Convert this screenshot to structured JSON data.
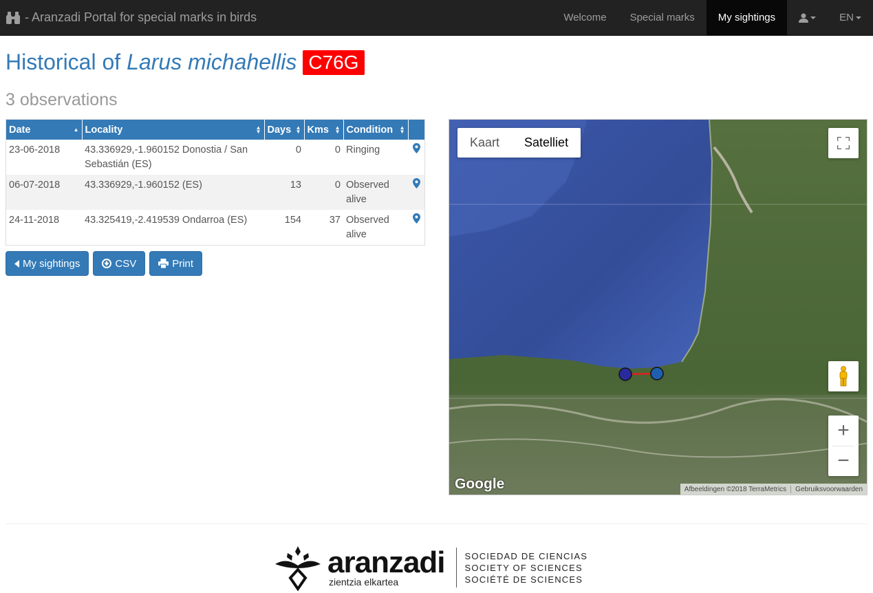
{
  "navbar": {
    "brand": "- Aranzadi Portal for special marks in birds",
    "items": [
      {
        "label": "Welcome",
        "active": false
      },
      {
        "label": "Special marks",
        "active": false
      },
      {
        "label": "My sightings",
        "active": true
      }
    ],
    "language": "EN"
  },
  "page": {
    "title_prefix": "Historical of",
    "species": "Larus michahellis",
    "mark_code": "C76G",
    "observations": "3 observations"
  },
  "table": {
    "headers": [
      "Date",
      "Locality",
      "Days",
      "Kms",
      "Condition"
    ],
    "rows": [
      {
        "date": "23-06-2018",
        "locality": "43.336929,-1.960152 Donostia / San Sebastián (ES)",
        "days": "0",
        "kms": "0",
        "condition": "Ringing"
      },
      {
        "date": "06-07-2018",
        "locality": "43.336929,-1.960152 (ES)",
        "days": "13",
        "kms": "0",
        "condition": "Observed alive"
      },
      {
        "date": "24-11-2018",
        "locality": "43.325419,-2.419539 Ondarroa (ES)",
        "days": "154",
        "kms": "37",
        "condition": "Observed alive"
      }
    ]
  },
  "buttons": {
    "back": "My sightings",
    "csv": "CSV",
    "print": "Print"
  },
  "map": {
    "types": [
      {
        "label": "Kaart",
        "selected": false
      },
      {
        "label": "Satelliet",
        "selected": true
      }
    ],
    "zoom_in": "+",
    "zoom_out": "−",
    "logo": "Google",
    "attribution": "Afbeeldingen ©2018 TerraMetrics",
    "terms": "Gebruiksvoorwaarden",
    "colors": {
      "sea": "#3b57a8",
      "land": "#4d6a3a",
      "marker_a": "#2a2a9c",
      "marker_b": "#1f5fb0",
      "route": "#e02020"
    }
  },
  "footer": {
    "logo_main": "aranzadi",
    "logo_sub": "zientzia elkartea",
    "lines": [
      "SOCIEDAD DE CIENCIAS",
      "SOCIETY OF SCIENCES",
      "SOCIÉTÉ DE SCIENCES"
    ]
  },
  "colors": {
    "primary": "#337ab7",
    "badge": "#ff0000",
    "navbar": "#222222"
  }
}
